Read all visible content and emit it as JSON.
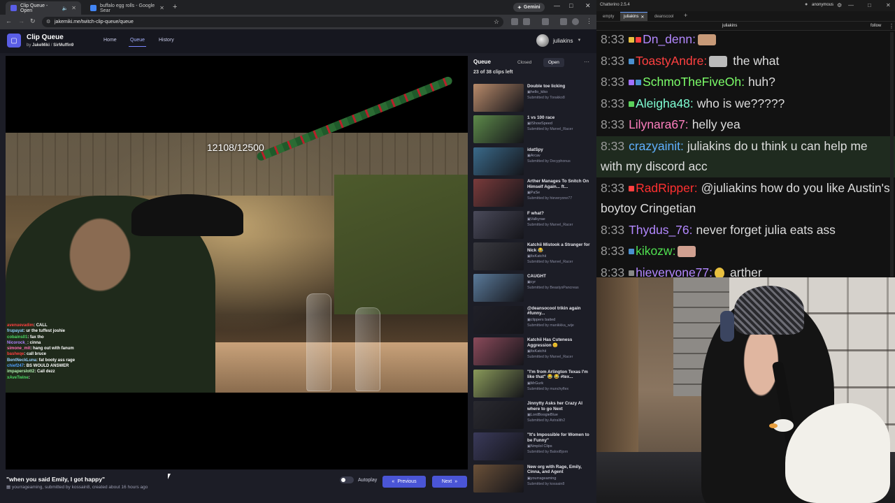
{
  "browser": {
    "tabs": [
      {
        "title": "Clip Queue - Open",
        "fav_color": "#5a5ee6"
      },
      {
        "title": "buffalo egg rolls - Google Sear",
        "fav_color": "#4285f4"
      }
    ],
    "gemini_label": "Gemini",
    "url": "jakemiki.me/twitch-clip-queue/queue"
  },
  "app": {
    "title": "Clip Queue",
    "by_label": "by",
    "author1": "JakeMiki",
    "author_sep": "/",
    "author2": "SirMuffin9",
    "nav": [
      "Home",
      "Queue",
      "History"
    ],
    "username": "juliakins"
  },
  "player": {
    "overlay_text": "12108/12500",
    "chat": [
      {
        "user": "avenuevadim",
        "color": "#ff4040",
        "msg": ": CALL"
      },
      {
        "user": "frupayat",
        "color": "#8fd0ff",
        "msg": ": ur the tuffest joshie"
      },
      {
        "user": "cobains01",
        "color": "#4cd964",
        "msg": ": fax tho"
      },
      {
        "user": "Nicorock_",
        "color": "#b080ff",
        "msg": ": cinna"
      },
      {
        "user": "simone_mit",
        "color": "#ff6fb5",
        "msg": ": hang out with fanum"
      },
      {
        "user": "basheqe",
        "color": "#ff4040",
        "msg": ": call bruce"
      },
      {
        "user": "BentNeckLuna",
        "color": "#9ad0ff",
        "msg": ": fat booty ass rage"
      },
      {
        "user": "chief247",
        "color": "#50a0ff",
        "msg": ": BS WOULD ANSWER"
      },
      {
        "user": "impaperslott2",
        "color": "#b0f0b0",
        "msg": ": Call dezz"
      },
      {
        "user": "xAveTwine",
        "color": "#4cd964",
        "msg": ": "
      }
    ]
  },
  "clip": {
    "title": "\"when you said Emily, I got happy\"",
    "channel": "yourrageaming",
    "meta_mid": ", submitted by",
    "submitter": "kossain8",
    "meta_tail": ", created about 16 hours ago"
  },
  "controls": {
    "autoplay_label": "Autoplay",
    "prev_label": "Previous",
    "next_label": "Next"
  },
  "queue": {
    "title": "Queue",
    "closed_label": "Closed",
    "open_label": "Open",
    "count_text": "23 of 38 clips left",
    "items": [
      {
        "title": "Double toe licking",
        "channel": "hello_kiko",
        "submitter": "Submitted by Torakko8",
        "thumb": "#b88a6a"
      },
      {
        "title": "1 vs 100 race",
        "channel": "IShowSpeed",
        "submitter": "Submitted by Marvel_Racer",
        "thumb": "#5d8a4a"
      },
      {
        "title": "idatSpy",
        "channel": "Arcav",
        "submitter": "Submitted by Decyphonus",
        "thumb": "#3a6a8a"
      },
      {
        "title": "Arther Manages To Snitch On Himself Again... ft...",
        "channel": "PaSe",
        "submitter": "Submitted by hieveryone77",
        "thumb": "#7a3b3b"
      },
      {
        "title": "F what?",
        "channel": "Valkyrae",
        "submitter": "Submitted by Marvel_Racer",
        "thumb": "#4a4a5a"
      },
      {
        "title": "Katchii Mistook a Stranger for Nick 😂",
        "channel": "ItsKatchii",
        "submitter": "Submitted by Marvel_Racer",
        "thumb": "#3a3a40"
      },
      {
        "title": "CAUGHT",
        "channel": "cyr",
        "submitter": "Submitted by BeastyxPancreas",
        "thumb": "#5a7a9a"
      },
      {
        "title": "@deansocool trikin again #funny...",
        "channel": "clippers baited",
        "submitter": "Submitted by manikkka_wije",
        "thumb": "#202028"
      },
      {
        "title": "Katchii Has Cuteness Aggression 😊",
        "channel": "ItsKatchii",
        "submitter": "Submitted by Marvel_Racer",
        "thumb": "#8a4a5a"
      },
      {
        "title": "\"I'm from Arlington Texas I'm like that\" 😂 😂 #tex...",
        "channel": "MrGurk",
        "submitter": "Submitted by munchyflex",
        "thumb": "#8a9a5a"
      },
      {
        "title": "Jinnytty Asks her Crazy AI where to go Next",
        "channel": "LordBoogieBlue",
        "submitter": "Submitted by Astralith2",
        "thumb": "#2a2a30"
      },
      {
        "title": "\"It's Impossible for Women to be Funny\"",
        "channel": "Nmplol Clips",
        "submitter": "Submitted by BalooBjorn",
        "thumb": "#3a3a5a"
      },
      {
        "title": "New org with Rage, Emily, Cinna, and Agent",
        "channel": "yourrageaming",
        "submitter": "Submitted by kossain8",
        "thumb": "#6a5038"
      }
    ]
  },
  "chatterino": {
    "version": "Chatterino 2.5.4",
    "account": "anonymous",
    "tabs": [
      "empty",
      "juliakins",
      "deanscool"
    ],
    "channel": "juliakins",
    "follow_label": "follow",
    "messages": [
      {
        "time": "8:33",
        "user": "Dn_denn:",
        "color": "#b388ff",
        "text": "",
        "emote": "#c89a78",
        "badges": [
          "#e8c040",
          "#ff4040"
        ]
      },
      {
        "time": "8:33",
        "user": "ToastyAndre:",
        "color": "#ff4040",
        "text": "the what",
        "emote": "#bbbbbb",
        "badges": [
          "#4a90d0"
        ]
      },
      {
        "time": "8:33",
        "user": "SchmoTheFiveOh:",
        "color": "#7dff6a",
        "text": "huh?",
        "emote": "",
        "badges": [
          "#a070ff",
          "#4a90d0"
        ]
      },
      {
        "time": "8:33",
        "user": "Aleigha48:",
        "color": "#7fffd4",
        "text": "who is we?????",
        "emote": "",
        "badges": [
          "#5ad05a"
        ]
      },
      {
        "time": "8:33",
        "user": "Lilynara67:",
        "color": "#ff7fbf",
        "text": "helly yea",
        "emote": "",
        "badges": []
      },
      {
        "time": "8:33",
        "user": "crazyainit:",
        "color": "#60b0ff",
        "text": "juliakins do u think u can help me with my discord acc",
        "emote": "",
        "badges": []
      },
      {
        "time": "8:33",
        "user": "RadRipper:",
        "color": "#ff3030",
        "text": "@juliakins how do you like Austin's boytoy Cringetian",
        "emote": "",
        "badges": [
          "#ff4040"
        ]
      },
      {
        "time": "8:33",
        "user": "Thydus_76:",
        "color": "#b388ff",
        "text": "never forget julia eats ass",
        "emote": "",
        "badges": []
      },
      {
        "time": "8:33",
        "user": "kikozw:",
        "color": "#50e050",
        "text": "",
        "emote": "#d0a090",
        "badges": [
          "#4a90d0"
        ]
      },
      {
        "time": "8:33",
        "user": "hieveryone77:",
        "color": "#b388ff",
        "text": "arther",
        "emote": "#e8c040",
        "badges": [
          "#888888"
        ]
      }
    ]
  }
}
